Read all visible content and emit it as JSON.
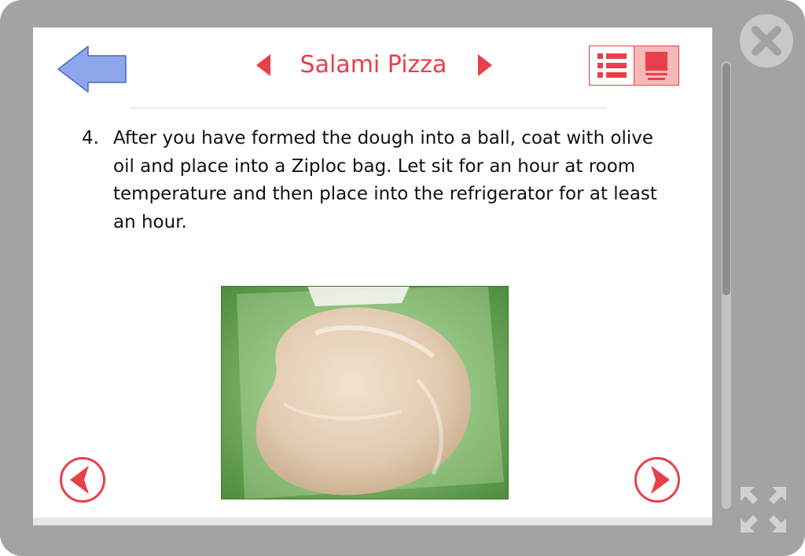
{
  "header": {
    "title": "Salami Pizza",
    "back_icon": "back-arrow-icon",
    "prev_icon": "triangle-left-icon",
    "next_icon": "triangle-right-icon"
  },
  "view_toggle": {
    "list_icon": "list-view-icon",
    "page_icon": "page-view-icon",
    "active": "page"
  },
  "step": {
    "number": "4.",
    "text": "After you have formed the dough into a ball, coat with olive oil and place into a Ziploc bag. Let sit for an hour at room temperature and then place into the refrigerator for at least an hour."
  },
  "photo": {
    "icon": "dough-in-ziploc-bag-photo"
  },
  "navigation": {
    "prev_icon": "circle-chevron-left-icon",
    "next_icon": "circle-chevron-right-icon"
  },
  "window": {
    "close_icon": "close-x-icon",
    "fullscreen_icon": "fullscreen-arrows-icon"
  },
  "colors": {
    "accent": "#e8404a",
    "back_arrow": "#8ea6ea",
    "frame": "#a3a3a3",
    "panel": "#ffffff"
  }
}
